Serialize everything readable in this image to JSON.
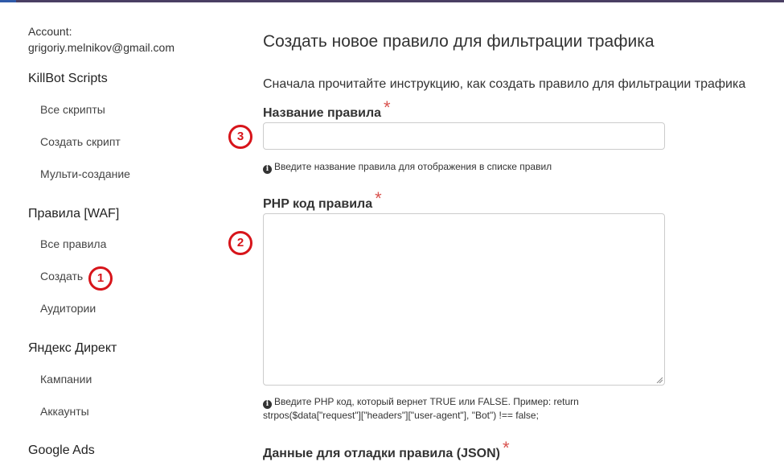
{
  "sidebar": {
    "account_label": "Account:",
    "account_email": "grigoriy.melnikov@gmail.com",
    "sections": [
      {
        "title": "KillBot Scripts",
        "items": [
          "Все скрипты",
          "Создать скрипт",
          "Мульти-создание"
        ]
      },
      {
        "title": "Правила [WAF]",
        "items": [
          "Все правила",
          "Создать",
          "Аудитории"
        ]
      },
      {
        "title": "Яндекс Директ",
        "items": [
          "Кампании",
          "Аккаунты"
        ]
      },
      {
        "title": "Google Ads",
        "items": []
      }
    ]
  },
  "main": {
    "title": "Создать новое правило для фильтрации трафика",
    "intro": "Сначала прочитайте инструкцию, как создать правило для фильтрации трафика",
    "fields": {
      "name": {
        "label": "Название правила",
        "required_mark": "*",
        "value": "",
        "help": "Введите название правила для отображения в списке правил"
      },
      "php": {
        "label": "PHP код правила",
        "required_mark": "*",
        "value": "",
        "help_line1": "Введите PHP код, который вернет TRUE или FALSE. Пример: return",
        "help_line2": "strpos($data[\"request\"][\"headers\"][\"user-agent\"], \"Bot\") !== false;"
      },
      "debug": {
        "label": "Данные для отладки правила (JSON)",
        "required_mark": "*"
      }
    }
  },
  "annotations": {
    "marker_1": "1",
    "marker_2": "2",
    "marker_3": "3"
  },
  "colors": {
    "top_bar": "#4a3f63",
    "required": "#d9534f",
    "marker": "#d7141a"
  }
}
